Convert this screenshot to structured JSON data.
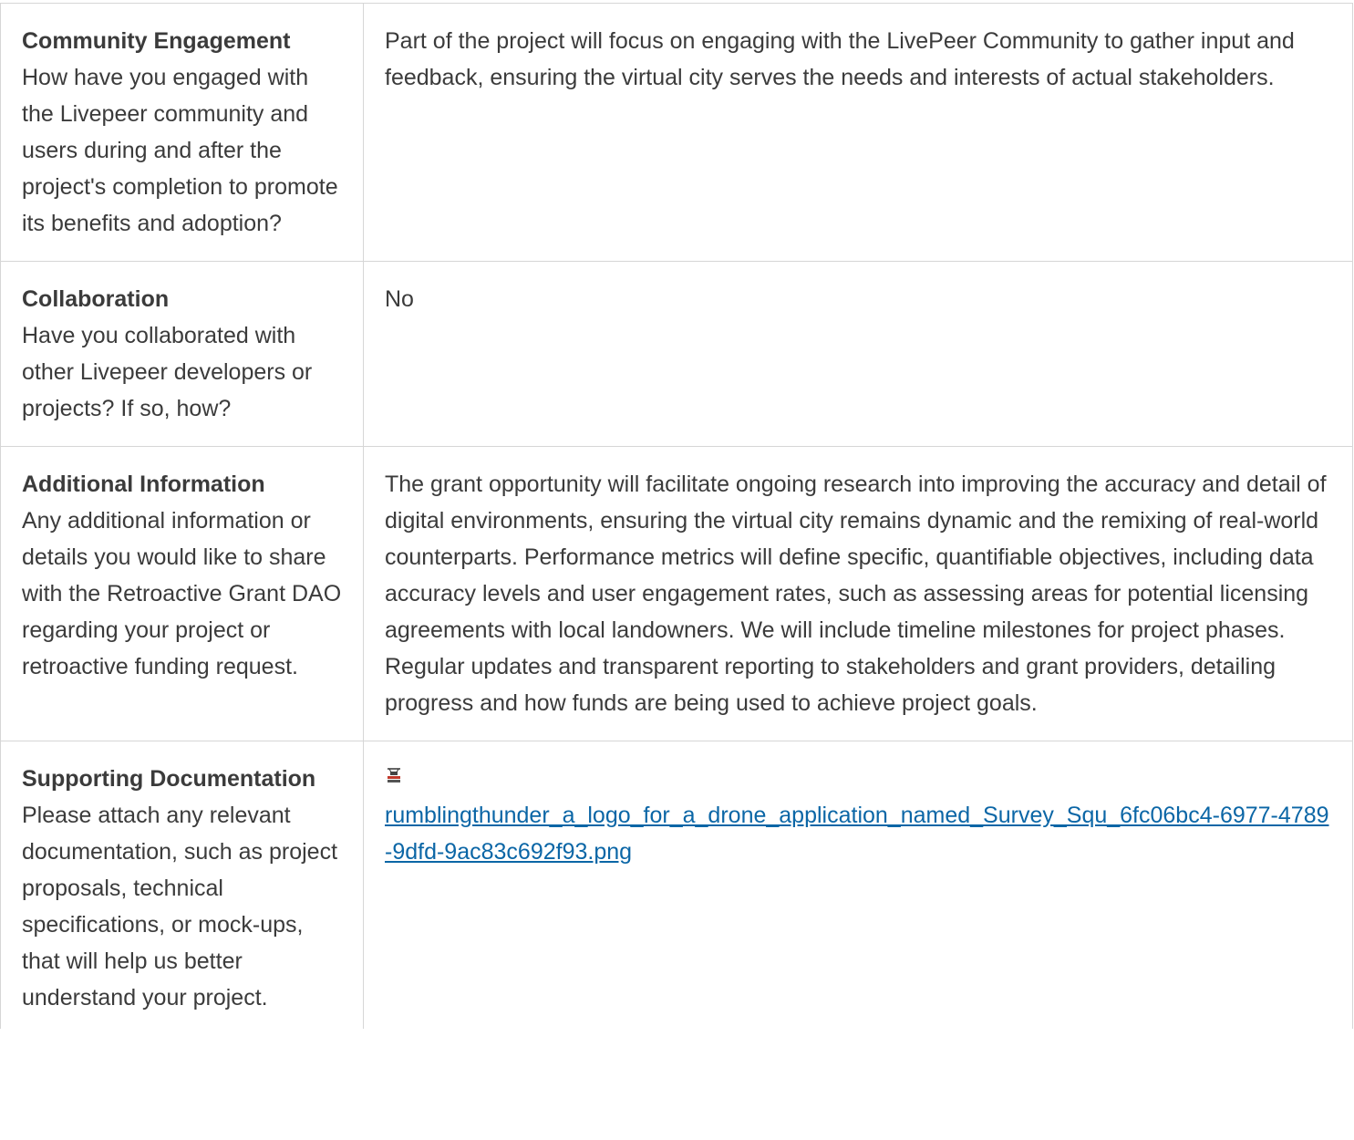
{
  "rows": [
    {
      "title": "Community Engagement",
      "question": "How have you engaged with the Livepeer community and users during and after the project's completion to promote its benefits and adoption?",
      "answer": "Part of the project will focus on engaging with the LivePeer Community to gather input and feedback, ensuring the virtual city serves the needs and interests of actual stakeholders."
    },
    {
      "title": "Collaboration",
      "question": "Have you collaborated with other Livepeer developers or projects? If so, how?",
      "answer": "No"
    },
    {
      "title": "Additional Information",
      "question": "Any additional information or details you would like to share with the Retroactive Grant DAO regarding your project or retroactive funding request.",
      "answer": "The grant opportunity will facilitate ongoing research into improving the accuracy and detail of digital environments, ensuring the virtual city remains dynamic and the remixing of real-world counterparts. Performance metrics will define specific, quantifiable objectives, including data accuracy levels and user engagement rates, such as assessing areas for potential licensing agreements with local landowners. We will include timeline milestones for project phases. Regular updates and transparent reporting to stakeholders and grant providers, detailing progress and how funds are being used to achieve project goals."
    },
    {
      "title": "Supporting Documentation",
      "question": "Please attach any relevant documentation, such as project proposals, technical specifications, or mock-ups, that will help us better understand your project.",
      "attachment": {
        "icon": "drone-logo-thumbnail-icon",
        "filename": "rumblingthunder_a_logo_for_a_drone_application_named_Survey_Squ_6fc06bc4-6977-4789-9dfd-9ac83c692f93.png"
      }
    }
  ],
  "colors": {
    "text": "#3b3b3b",
    "border": "#d6d6d6",
    "link": "#0b66a6"
  }
}
